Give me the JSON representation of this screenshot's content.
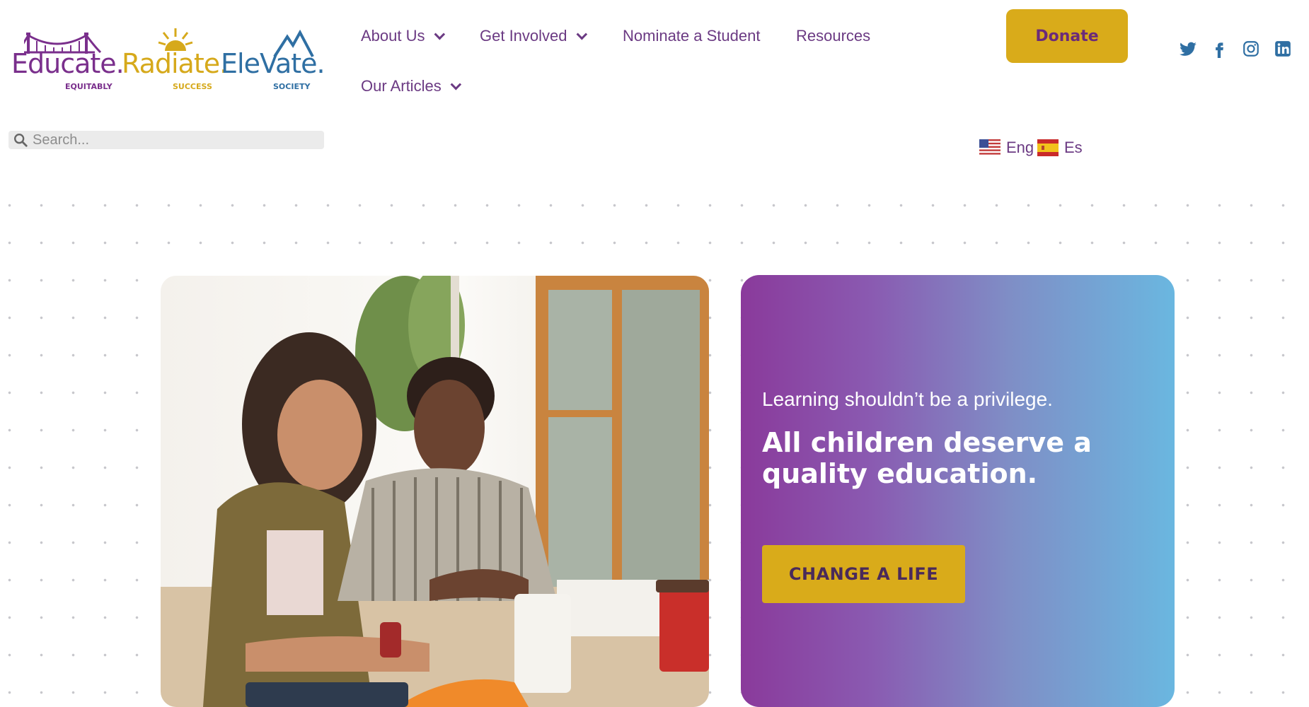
{
  "logo": {
    "word1": "Educate.",
    "word2": "Radiate.",
    "word3": "EleVate.",
    "sub1": "EQUITABLY",
    "sub2": "SUCCESS",
    "sub3": "SOCIETY"
  },
  "nav": {
    "about": "About Us",
    "involved": "Get Involved",
    "nominate": "Nominate a Student",
    "resources": "Resources",
    "articles": "Our Articles"
  },
  "donate_label": "Donate",
  "social": [
    "twitter-icon",
    "facebook-icon",
    "instagram-icon",
    "linkedin-icon"
  ],
  "search": {
    "placeholder": "Search..."
  },
  "languages": {
    "english": "Eng",
    "spanish": "Es"
  },
  "hero": {
    "tagline": "Learning shouldn’t be a privilege.",
    "headline": "All children deserve a quality education.",
    "cta": "CHANGE A LIFE"
  },
  "colors": {
    "purple": "#6b3a83",
    "gold": "#d9ab1a",
    "gradient_start": "#8a3a9b",
    "gradient_end": "#6ab7e0"
  }
}
